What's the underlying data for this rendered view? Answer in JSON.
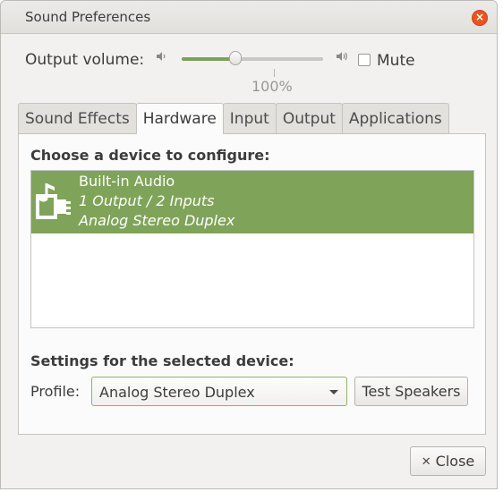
{
  "window": {
    "title": "Sound Preferences",
    "close_glyph": "×"
  },
  "volume": {
    "label": "Output volume:",
    "level_fraction": 0.38,
    "percent_label": "100%",
    "mute_label": "Mute",
    "mute_checked": false,
    "icons": [
      "speaker-low-icon",
      "speaker-high-icon"
    ]
  },
  "tabs": [
    {
      "label": "Sound Effects",
      "active": false
    },
    {
      "label": "Hardware",
      "active": true
    },
    {
      "label": "Input",
      "active": false
    },
    {
      "label": "Output",
      "active": false
    },
    {
      "label": "Applications",
      "active": false
    }
  ],
  "hardware": {
    "choose_heading": "Choose a device to configure:",
    "devices": [
      {
        "name": "Built-in Audio",
        "ports": "1 Output / 2 Inputs",
        "profile": "Analog Stereo Duplex",
        "icon": "audio-card-icon",
        "selected": true
      }
    ],
    "settings_heading": "Settings for the selected device:",
    "profile_label": "Profile:",
    "profile_value": "Analog Stereo Duplex",
    "test_button": "Test Speakers"
  },
  "footer": {
    "close_button": "Close",
    "close_icon": "close-x-icon"
  },
  "colors": {
    "accent": "#7fa459",
    "close_button_red": "#e95420"
  }
}
